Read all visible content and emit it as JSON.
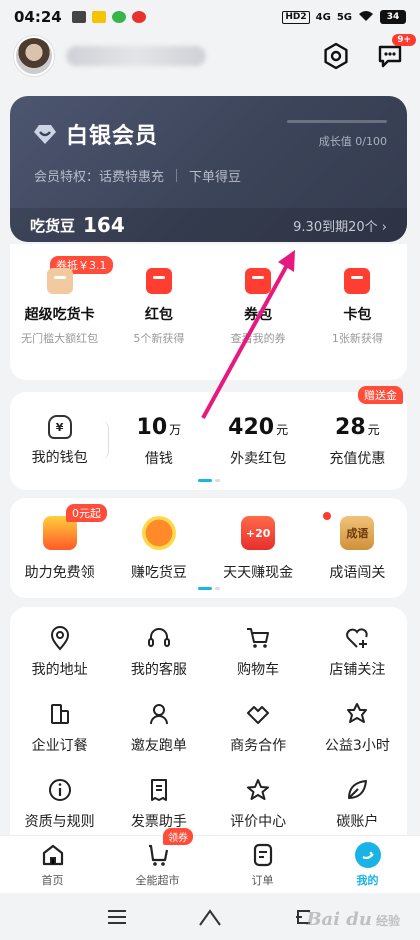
{
  "status": {
    "time": "04:24",
    "net": [
      "HD2",
      "4G",
      "5G"
    ],
    "battery": "34"
  },
  "header": {
    "message_badge": "9+"
  },
  "vip": {
    "title": "白银会员",
    "growth_text": "成长值 0/100",
    "growth_progress": 0,
    "rights_label": "会员特权：话费特惠充",
    "rights_label2": "下单得豆",
    "beans_label": "吃货豆",
    "beans_value": "164",
    "expire_text": "9.30到期20个",
    "expire_arrow": "›"
  },
  "coupons": [
    {
      "name": "超级吃货卡",
      "sub": "无门槛大额红包",
      "tag": "券抵￥3.1"
    },
    {
      "name": "红包",
      "sub": "5个新获得"
    },
    {
      "name": "券包",
      "sub": "查看我的券"
    },
    {
      "name": "卡包",
      "sub": "1张新获得"
    }
  ],
  "wallet": {
    "items": [
      {
        "label": "我的钱包",
        "icon_text": "¥"
      },
      {
        "num": "10",
        "unit": "万",
        "label": "借钱"
      },
      {
        "num": "420",
        "unit": "元",
        "label": "外卖红包"
      },
      {
        "num": "28",
        "unit": "元",
        "label": "充值优惠",
        "tag": "赠送金"
      }
    ]
  },
  "games": {
    "items": [
      {
        "label": "助力免费领",
        "tag": "0元起"
      },
      {
        "label": "赚吃货豆"
      },
      {
        "label": "天天赚现金",
        "overlay": "+20"
      },
      {
        "label": "成语闯关",
        "overlay": "成语"
      }
    ]
  },
  "services": [
    {
      "label": "我的地址",
      "icon": "location-icon"
    },
    {
      "label": "我的客服",
      "icon": "headset-icon"
    },
    {
      "label": "购物车",
      "icon": "cart-icon"
    },
    {
      "label": "店铺关注",
      "icon": "heart-plus-icon"
    },
    {
      "label": "企业订餐",
      "icon": "building-icon"
    },
    {
      "label": "邀友跑单",
      "icon": "rider-icon"
    },
    {
      "label": "商务合作",
      "icon": "handshake-icon"
    },
    {
      "label": "公益3小时",
      "icon": "charity-icon"
    },
    {
      "label": "资质与规则",
      "icon": "info-icon"
    },
    {
      "label": "发票助手",
      "icon": "invoice-icon"
    },
    {
      "label": "评价中心",
      "icon": "star-icon"
    },
    {
      "label": "碳账户",
      "icon": "leaf-icon"
    }
  ],
  "tabs": [
    {
      "label": "首页",
      "icon": "home-icon"
    },
    {
      "label": "全能超市",
      "icon": "market-icon",
      "tag": "领券"
    },
    {
      "label": "订单",
      "icon": "order-icon"
    },
    {
      "label": "我的",
      "icon": "me-icon",
      "active": true
    }
  ],
  "watermark": {
    "main": "Bai du",
    "sub": "经验"
  },
  "colors": {
    "accent": "#19b3e6",
    "red": "#ff3d30",
    "vip_bg": "#3c4459"
  }
}
